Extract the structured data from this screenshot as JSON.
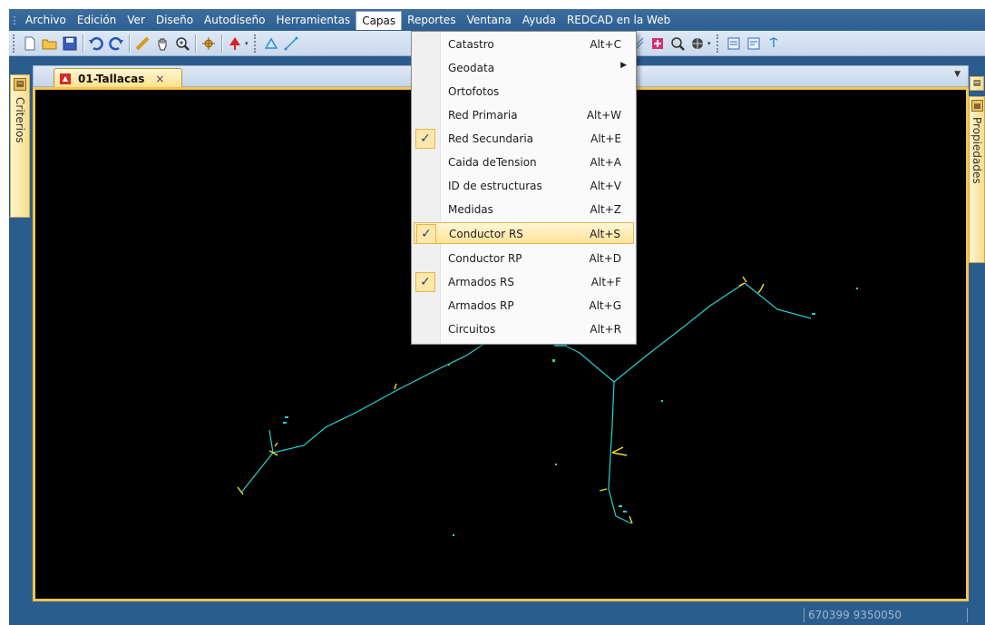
{
  "menubar": {
    "items": [
      "Archivo",
      "Edición",
      "Ver",
      "Diseño",
      "Autodiseño",
      "Herramientas",
      "Capas",
      "Reportes",
      "Ventana",
      "Ayuda",
      "REDCAD en la Web"
    ],
    "open_item": "Capas"
  },
  "toolbar": {
    "icons": [
      "new-file-icon",
      "open-folder-icon",
      "save-icon",
      "undo-icon",
      "redo-icon",
      "measure-icon",
      "pan-hand-icon",
      "zoom-icon",
      "snap-icon",
      "marker-icon",
      "layer-icon",
      "line-icon",
      "node-icon",
      "branch-icon",
      "conductor-a-icon",
      "conductor-b-icon",
      "conductor-c-icon",
      "structure-icon",
      "inspect-icon",
      "print-icon",
      "report-a-icon",
      "report-b-icon",
      "transform-icon"
    ]
  },
  "left_panel": {
    "tab_label": "Criterios"
  },
  "right_panel": {
    "tab_label": "Propiedades"
  },
  "document": {
    "tab_label": "01-Tallacas",
    "close_glyph": "×",
    "dropdown_glyph": "▼"
  },
  "status": {
    "coords": "670399 9350050"
  },
  "capas_menu": {
    "items": [
      {
        "label": "Catastro",
        "shortcut": "Alt+C",
        "checked": false,
        "submenu": false
      },
      {
        "label": "Geodata",
        "shortcut": "",
        "checked": false,
        "submenu": true
      },
      {
        "label": "Ortofotos",
        "shortcut": "",
        "checked": false,
        "submenu": false
      },
      {
        "label": "Red Primaria",
        "shortcut": "Alt+W",
        "checked": false,
        "submenu": false
      },
      {
        "label": "Red Secundaria",
        "shortcut": "Alt+E",
        "checked": true,
        "submenu": false
      },
      {
        "label": "Caida deTension",
        "shortcut": "Alt+A",
        "checked": false,
        "submenu": false
      },
      {
        "label": "ID de estructuras",
        "shortcut": "Alt+V",
        "checked": false,
        "submenu": false
      },
      {
        "label": "Medidas",
        "shortcut": "Alt+Z",
        "checked": false,
        "submenu": false
      },
      {
        "label": "Conductor RS",
        "shortcut": "Alt+S",
        "checked": true,
        "submenu": false,
        "highlighted": true
      },
      {
        "label": "Conductor RP",
        "shortcut": "Alt+D",
        "checked": false,
        "submenu": false
      },
      {
        "label": "Armados RS",
        "shortcut": "Alt+F",
        "checked": true,
        "submenu": false
      },
      {
        "label": "Armados RP",
        "shortcut": "Alt+G",
        "checked": false,
        "submenu": false
      },
      {
        "label": "Circuitos",
        "shortcut": "Alt+R",
        "checked": false,
        "submenu": false
      }
    ]
  },
  "colors": {
    "window_frame": "#2b5c8e",
    "canvas_background": "#000000",
    "network_line": "#25d3d3",
    "structure_marker": "#f2e21a",
    "menu_highlight": "#fde39a",
    "check_color": "#1a3d8f"
  }
}
